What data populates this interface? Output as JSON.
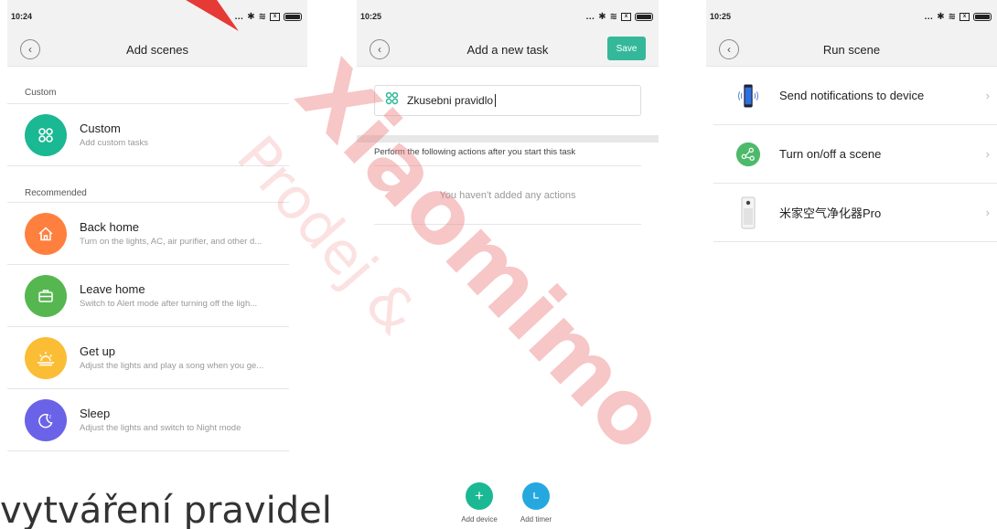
{
  "screen1": {
    "time": "10:24",
    "title": "Add scenes",
    "sections": {
      "custom_label": "Custom",
      "recommended_label": "Recommended"
    },
    "custom_item": {
      "title": "Custom",
      "desc": "Add custom tasks",
      "icon": "grid-icon",
      "color": "#1ab893"
    },
    "recommended": [
      {
        "title": "Back home",
        "desc": "Turn on the lights, AC, air purifier, and other d...",
        "icon": "home-icon",
        "color": "#ff7f3f"
      },
      {
        "title": "Leave home",
        "desc": "Switch to Alert mode after turning off the ligh...",
        "icon": "briefcase-icon",
        "color": "#56b650"
      },
      {
        "title": "Get up",
        "desc": "Adjust the lights and play a song when you ge...",
        "icon": "sunrise-icon",
        "color": "#fbbd36"
      },
      {
        "title": "Sleep",
        "desc": "Adjust the lights and switch to Night mode",
        "icon": "moon-icon",
        "color": "#6a63e8"
      }
    ]
  },
  "screen2": {
    "time": "10:25",
    "title": "Add a new task",
    "save_label": "Save",
    "task_name": "Zkusebni pravidlo",
    "actions_label": "Perform the following actions after you start this task",
    "empty_actions": "You haven't added any actions",
    "add_device_label": "Add device",
    "add_timer_label": "Add timer",
    "accent": "#35b89a",
    "timer_color": "#25a8e0"
  },
  "screen3": {
    "time": "10:25",
    "title": "Run scene",
    "items": [
      {
        "title": "Send notifications to device",
        "icon": "phone-notification-icon"
      },
      {
        "title": "Turn on/off a scene",
        "icon": "scene-share-icon"
      },
      {
        "title": "米家空气净化器Pro",
        "icon": "air-purifier-icon"
      }
    ]
  },
  "overlay": {
    "watermark_big": "Xiaomimo",
    "watermark_small": "Prodej &",
    "bottom_text": "vytváření pravidel"
  }
}
